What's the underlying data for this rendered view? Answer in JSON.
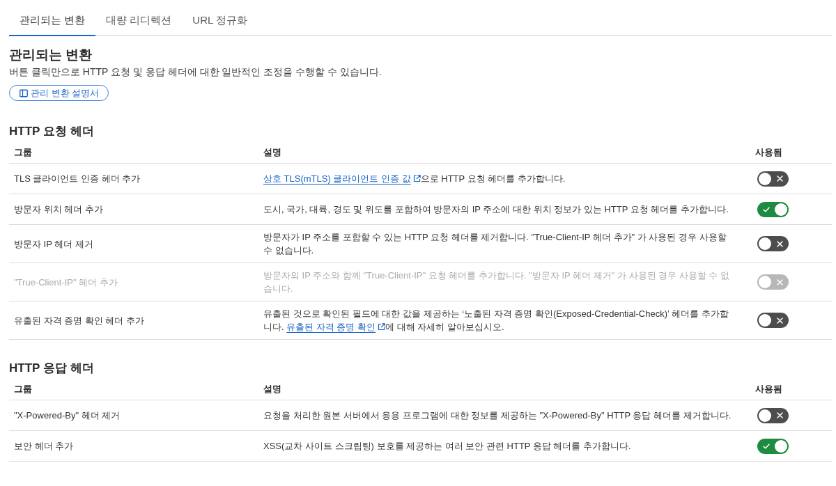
{
  "tabs": [
    {
      "label": "관리되는 변환",
      "selected": true
    },
    {
      "label": "대량 리디렉션",
      "selected": false
    },
    {
      "label": "URL 정규화",
      "selected": false
    }
  ],
  "intro": {
    "title": "관리되는 변환",
    "subtitle": "버튼 클릭만으로 HTTP 요청 및 응답 헤더에 대한 일반적인 조정을 수행할 수 있습니다.",
    "docs_button": "관리 변환 설명서"
  },
  "sections": [
    {
      "title": "HTTP 요청 헤더",
      "columns": [
        "그룹",
        "설명",
        "사용됨"
      ],
      "rows": [
        {
          "group": "TLS 클라이언트 인증 헤더 추가",
          "description": [
            {
              "kind": "link",
              "text": "상호 TLS(mTLS) 클라이언트 인증 값"
            },
            {
              "kind": "text",
              "text": "으로 HTTP 요청 헤더를 추가합니다."
            }
          ],
          "enabled": false,
          "disabled": false
        },
        {
          "group": "방문자 위치 헤더 추가",
          "description": [
            {
              "kind": "text",
              "text": "도시, 국가, 대륙, 경도 및 위도를 포함하여 방문자의 IP 주소에 대한 위치 정보가 있는 HTTP 요청 헤더를 추가합니다."
            }
          ],
          "enabled": true,
          "disabled": false
        },
        {
          "group": "방문자 IP 헤더 제거",
          "description": [
            {
              "kind": "text",
              "text": "방문자가 IP 주소를 포함할 수 있는 HTTP 요청 헤더를 제거합니다. \"True-Client-IP 헤더 추가\" 가 사용된 경우 사용할 수 없습니다."
            }
          ],
          "enabled": false,
          "disabled": false
        },
        {
          "group": "\"True-Client-IP\" 헤더 추가",
          "description": [
            {
              "kind": "text",
              "text": "방문자의 IP 주소와 함께 \"True-Client-IP\" 요청 헤더를 추가합니다. \"방문자 IP 헤더 제거\" 가 사용된 경우 사용할 수 없습니다."
            }
          ],
          "enabled": false,
          "disabled": true
        },
        {
          "group": "유출된 자격 증명 확인 헤더 추가",
          "description": [
            {
              "kind": "text",
              "text": "유출된 것으로 확인된 필드에 대한 값을 제공하는 ‘노출된 자격 증명 확인(Exposed-Credential-Check)’ 헤더를 추가합니다. "
            },
            {
              "kind": "link",
              "text": "유출된 자격 증명 확인"
            },
            {
              "kind": "text",
              "text": "에 대해 자세히 알아보십시오."
            }
          ],
          "enabled": false,
          "disabled": false
        }
      ]
    },
    {
      "title": "HTTP 응답 헤더",
      "columns": [
        "그룹",
        "설명",
        "사용됨"
      ],
      "rows": [
        {
          "group": "\"X-Powered-By\" 헤더 제거",
          "description": [
            {
              "kind": "text",
              "text": "요청을 처리한 원본 서버에서 응용 프로그램에 대한 정보를 제공하는 \"X-Powered-By\" HTTP 응답 헤더를 제거합니다."
            }
          ],
          "enabled": false,
          "disabled": false
        },
        {
          "group": "보안 헤더 추가",
          "description": [
            {
              "kind": "text",
              "text": "XSS(교차 사이트 스크립팅) 보호를 제공하는 여러 보안 관련 HTTP 응답 헤더를 추가합니다."
            }
          ],
          "enabled": true,
          "disabled": false
        }
      ]
    }
  ]
}
